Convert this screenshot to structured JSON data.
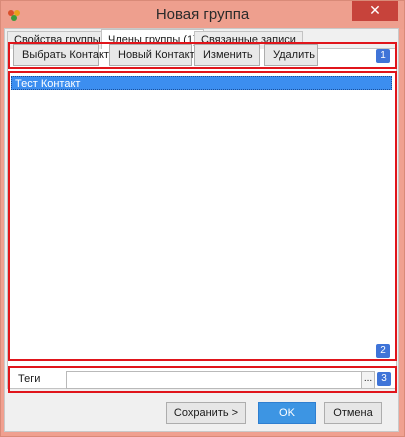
{
  "window": {
    "title": "Новая группа",
    "close_symbol": "✕",
    "icon": "app-icon"
  },
  "tabs": [
    {
      "label": "Свойства группы",
      "active": false
    },
    {
      "label": "Члены группы (1)",
      "active": true
    },
    {
      "label": "Связанные записи",
      "active": false
    }
  ],
  "toolbar": {
    "buttons": [
      "Выбрать Контакт",
      "Новый Контакт",
      "Изменить",
      "Удалить"
    ],
    "badge": "1"
  },
  "members": {
    "items": [
      "Тест Контакт"
    ],
    "badge": "2"
  },
  "tags": {
    "label": "Теги",
    "value": "",
    "more_button": "...",
    "badge": "3"
  },
  "footer": {
    "save_label": "Сохранить >",
    "ok_label": "OK",
    "cancel_label": "Отмена"
  },
  "colors": {
    "title_bar": "#ee9f8e",
    "close": "#c7433b",
    "annotation_border": "#e0151b",
    "badge": "#3f74d8",
    "selection": "#3c8ef0",
    "ok_button": "#3d95e3"
  }
}
